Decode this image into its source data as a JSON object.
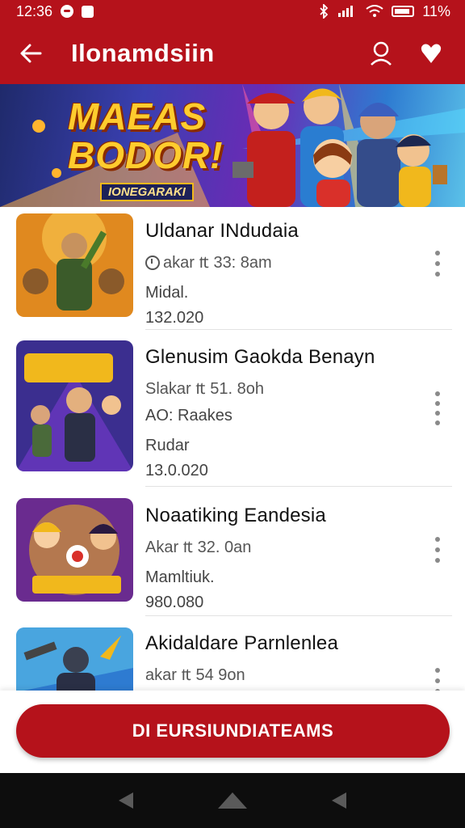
{
  "status_bar": {
    "time": "12:36",
    "battery_text": "11%",
    "signal_text": "ᛒ ≋ıl",
    "icons": [
      "notification-dot-icon",
      "notification-square-icon",
      "bluetooth-icon",
      "signal-icon",
      "wifi-icon",
      "battery-icon"
    ]
  },
  "app_bar": {
    "title": "Ilonamdsiin",
    "icons": [
      "back-arrow-icon",
      "profile-icon",
      "heart-icon"
    ]
  },
  "banner": {
    "title_line1": "MAEAS",
    "title_line2": "BODOR!",
    "subtitle": "IONEGARAKI",
    "colors": {
      "title": "#ffcc2e",
      "shadow": "#8a2b00"
    }
  },
  "games": [
    {
      "title": "Uldanar INdudaia",
      "meta": "akar ₶ 33: 8am",
      "line2": "",
      "line3": "Midal.",
      "line4": "132.020"
    },
    {
      "title": "Glenusim Gaokda Benayn",
      "meta": "Slakar ₶ 51. 8oh",
      "line2": "AO: Raakes",
      "line3": "Rudar",
      "line4": "13.0.020"
    },
    {
      "title": "Noaatiking Eandesia",
      "meta": "Akar ₶ 32. 0an",
      "line2": "",
      "line3": "Mamltiuk.",
      "line4": "980.080"
    },
    {
      "title": "Akidaldare Parnlenlea",
      "meta": "akar ₶ 54 9on",
      "line2": "",
      "line3": "",
      "line4": ""
    }
  ],
  "cta": {
    "label": "DI EURSIUNDIATEAMS"
  },
  "nav": {
    "icons": [
      "back-triangle-icon",
      "home-icon",
      "recent-triangle-icon"
    ]
  },
  "colors": {
    "primary": "#b5121b",
    "nav": "#0d0d0d",
    "text": "#111111"
  }
}
